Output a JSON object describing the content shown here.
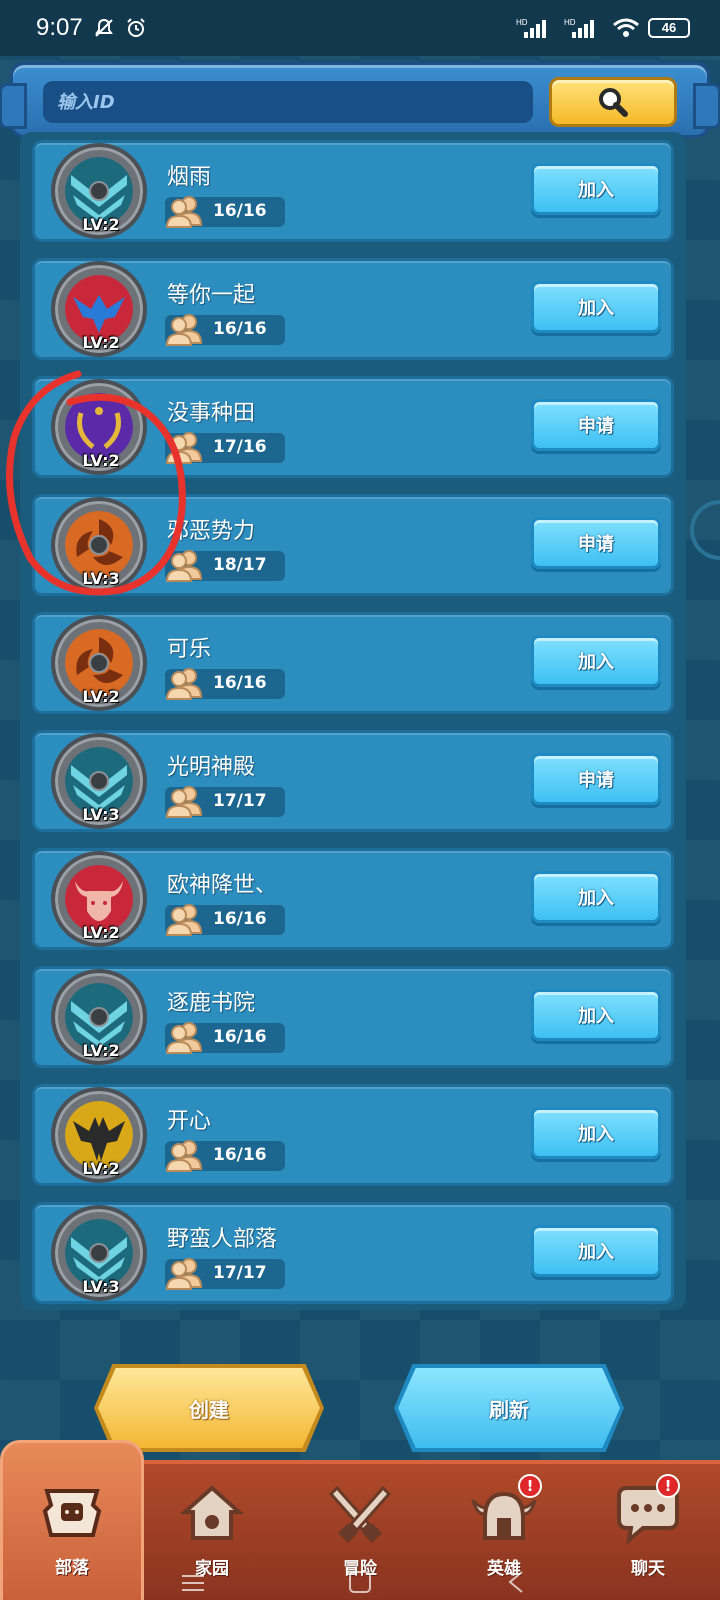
{
  "status_bar": {
    "time": "9:07",
    "battery": "46",
    "net1": "HD",
    "net2": "HD"
  },
  "search": {
    "placeholder": "输入ID",
    "icon": "search-icon"
  },
  "clans": [
    {
      "name": "烟雨",
      "level": "LV:2",
      "members": "16/16",
      "action": "加入",
      "emblem": "shield-teal"
    },
    {
      "name": "等你一起",
      "level": "LV:2",
      "members": "16/16",
      "action": "加入",
      "emblem": "eagle-red"
    },
    {
      "name": "没事种田",
      "level": "LV:2",
      "members": "17/16",
      "action": "申请",
      "emblem": "laurel-purple"
    },
    {
      "name": "邪恶势力",
      "level": "LV:3",
      "members": "18/17",
      "action": "申请",
      "emblem": "triskele-orange"
    },
    {
      "name": "可乐",
      "level": "LV:2",
      "members": "16/16",
      "action": "加入",
      "emblem": "triskele-orange"
    },
    {
      "name": "光明神殿",
      "level": "LV:3",
      "members": "17/17",
      "action": "申请",
      "emblem": "shield-teal"
    },
    {
      "name": "欧神降世、",
      "level": "LV:2",
      "members": "16/16",
      "action": "加入",
      "emblem": "bull-red"
    },
    {
      "name": "逐鹿书院",
      "level": "LV:2",
      "members": "16/16",
      "action": "加入",
      "emblem": "shield-teal"
    },
    {
      "name": "开心",
      "level": "LV:2",
      "members": "16/16",
      "action": "加入",
      "emblem": "eagle-gold"
    },
    {
      "name": "野蛮人部落",
      "level": "LV:3",
      "members": "17/17",
      "action": "加入",
      "emblem": "shield-teal"
    }
  ],
  "actions": {
    "create": "创建",
    "refresh": "刷新"
  },
  "nav": [
    {
      "label": "部落",
      "icon": "tribe-icon",
      "active": true
    },
    {
      "label": "家园",
      "icon": "home-icon",
      "active": false
    },
    {
      "label": "冒险",
      "icon": "crossed-swords-icon",
      "active": false
    },
    {
      "label": "英雄",
      "icon": "viking-helmet-icon",
      "active": false,
      "badge": "!"
    },
    {
      "label": "聊天",
      "icon": "chat-icon",
      "active": false,
      "badge": "!"
    }
  ],
  "colors": {
    "background": "#164e6b",
    "row": "#2c8dbf",
    "join_button": "#3ec0f2",
    "create_button": "#f3b733",
    "nav_bar": "#b04a2a",
    "annotation": "#e8322c"
  }
}
